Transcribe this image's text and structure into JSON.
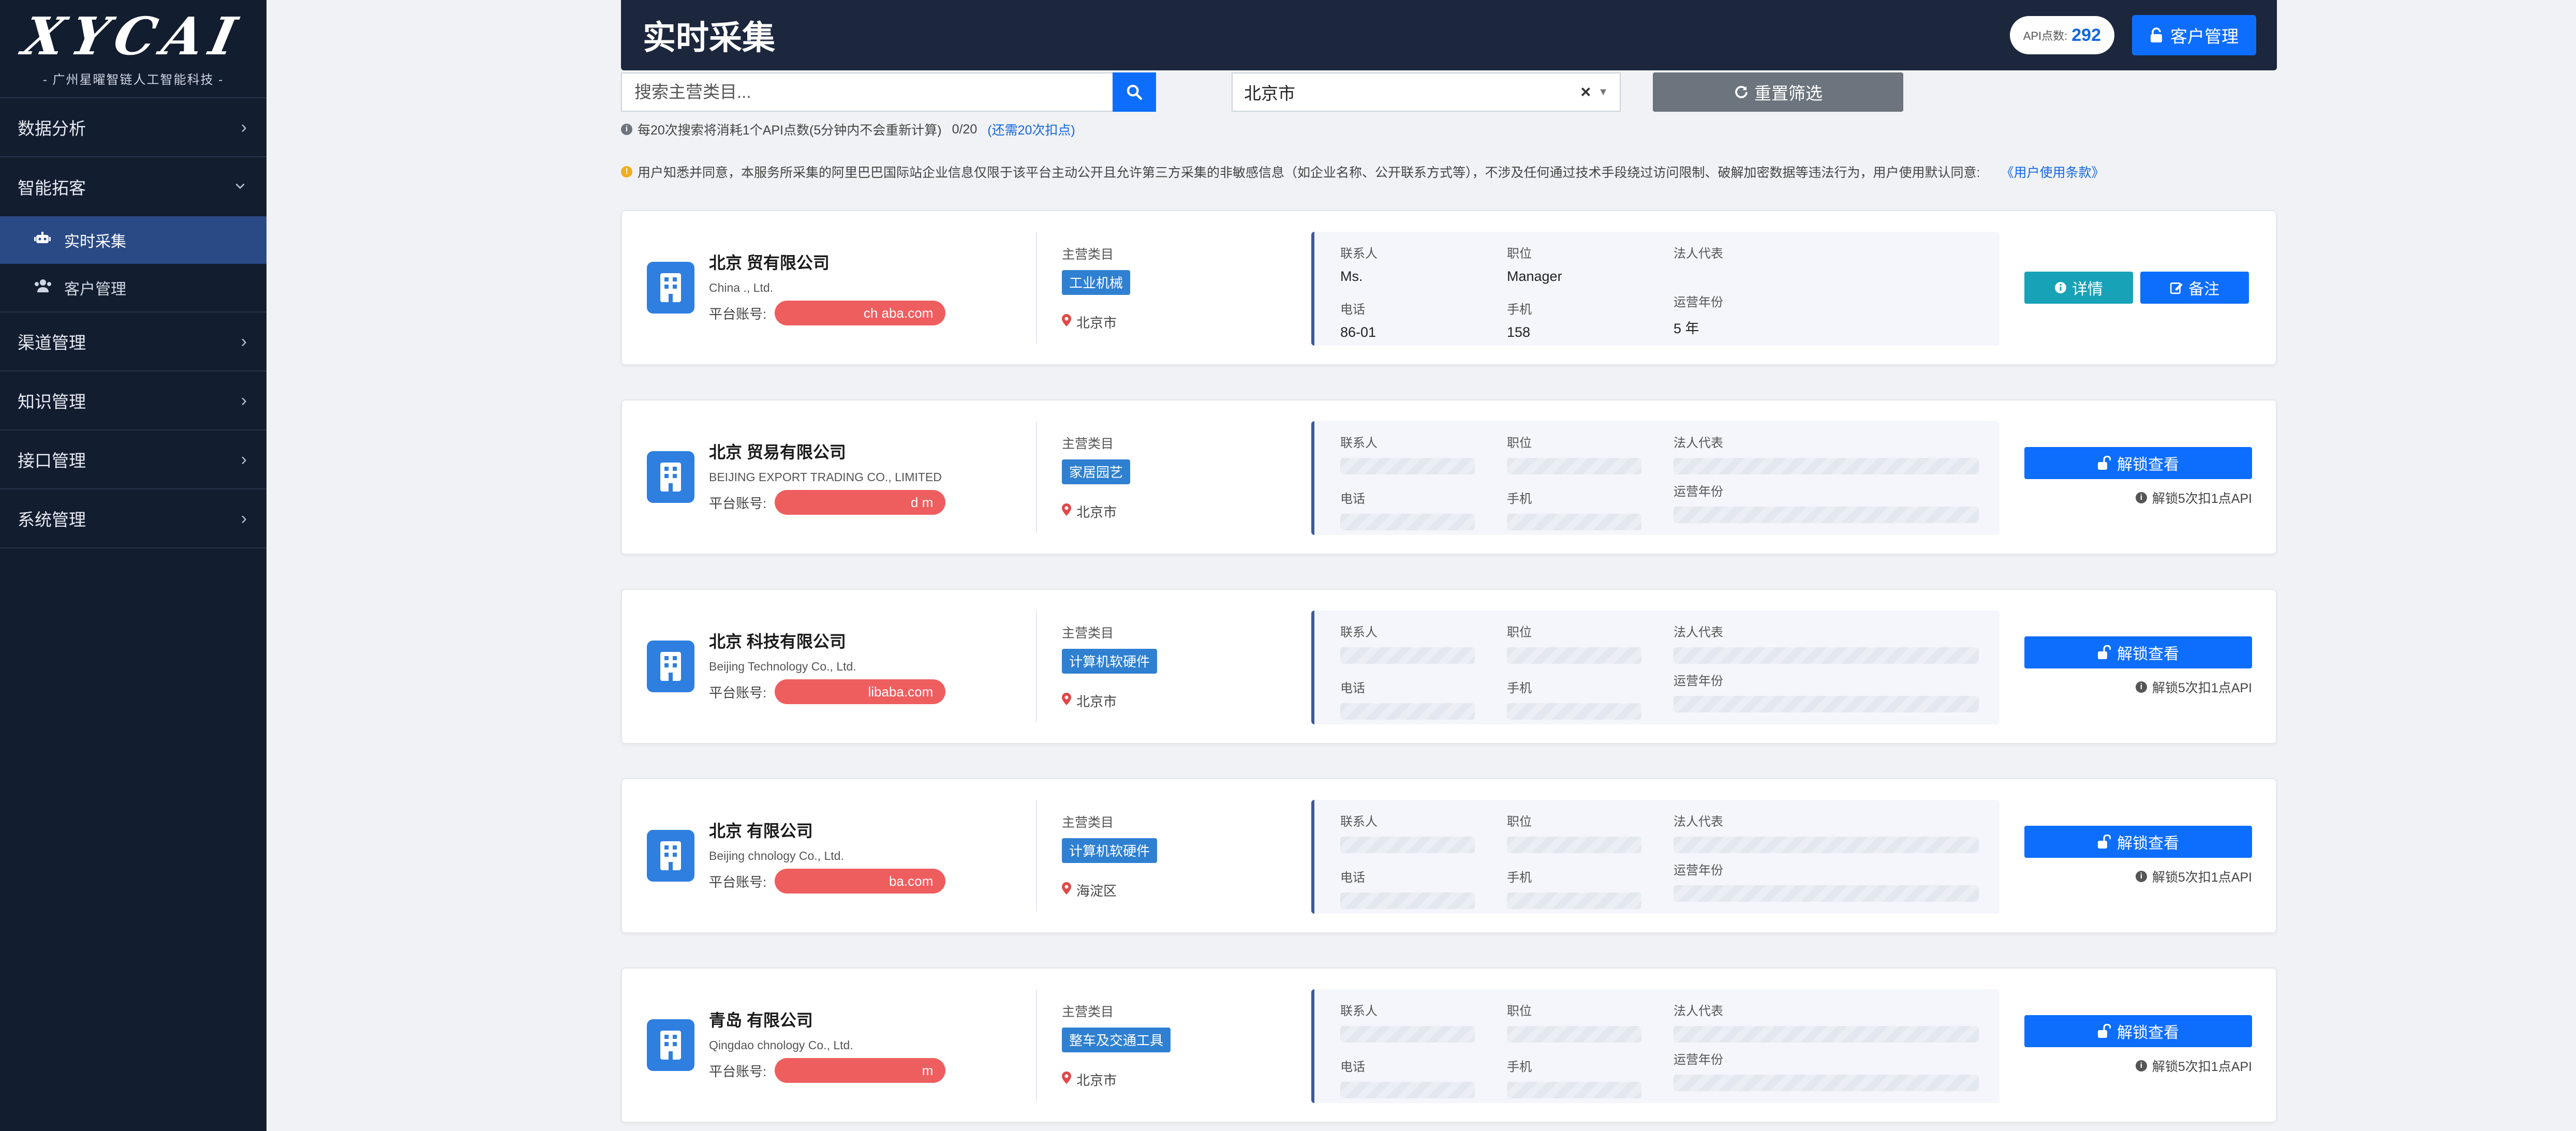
{
  "sidebar": {
    "logo": "XYCAI",
    "logo_sub": "- 广州星曜智链人工智能科技 -",
    "menu": [
      {
        "label": "数据分析",
        "chevron": "›"
      },
      {
        "label": "智能拓客",
        "chevron": "⌄"
      },
      {
        "label": "渠道管理",
        "chevron": "›"
      },
      {
        "label": "知识管理",
        "chevron": "›"
      },
      {
        "label": "接口管理",
        "chevron": "›"
      },
      {
        "label": "系统管理",
        "chevron": "›"
      }
    ],
    "submenu": [
      {
        "label": "实时采集",
        "icon": "robot-icon"
      },
      {
        "label": "客户管理",
        "icon": "users-icon"
      }
    ]
  },
  "header": {
    "title": "实时采集",
    "api_label": "API点数:",
    "api_value": "292",
    "customer_btn": "客户管理"
  },
  "filters": {
    "search_placeholder": "搜索主营类目...",
    "city_value": "北京市",
    "clear_glyph": "×",
    "reset_label": "重置筛选"
  },
  "hint": {
    "text": "每20次搜索将消耗1个API点数(5分钟内不会重新计算)",
    "count": "0/20",
    "remain": "(还需20次扣点)"
  },
  "notice": {
    "text": "用户知悉并同意，本服务所采集的阿里巴巴国际站企业信息仅限于该平台主动公开且允许第三方采集的非敏感信息（如企业名称、公开联系方式等），不涉及任何通过技术手段绕过访问限制、破解加密数据等违法行为，用户使用默认同意:",
    "link": "《用户使用条款》"
  },
  "labels": {
    "category": "主营类目",
    "account": "平台账号:",
    "contact": "联系人",
    "position": "职位",
    "legal_rep": "法人代表",
    "phone": "电话",
    "mobile": "手机",
    "years": "运营年份",
    "detail": "详情",
    "note": "备注",
    "unlock": "解锁查看",
    "unlock_hint": "解锁5次扣1点API"
  },
  "cards": [
    {
      "name": "北京                    贸有限公司",
      "name_en": "China                            ., Ltd.",
      "account": "ch                    aba.com",
      "category": "工业机械",
      "location": "北京市",
      "unlocked": true,
      "contact": "Ms.",
      "position": "Manager",
      "phone": "86-01",
      "mobile": "158",
      "years": "5 年"
    },
    {
      "name": "北京                           贸易有限公司",
      "name_en": "BEIJING                                      EXPORT TRADING CO., LIMITED",
      "account": "d                    m",
      "category": "家居园艺",
      "location": "北京市",
      "unlocked": false
    },
    {
      "name": "北京                      科技有限公司",
      "name_en": "Beijing                          Technology Co., Ltd.",
      "account": "                  libaba.com",
      "category": "计算机软硬件",
      "location": "北京市",
      "unlocked": false
    },
    {
      "name": "北京                      有限公司",
      "name_en": "Beijing                           chnology Co., Ltd.",
      "account": "                   ba.com",
      "category": "计算机软硬件",
      "location": "海淀区",
      "unlocked": false
    },
    {
      "name": "青岛                         有限公司",
      "name_en": "Qingdao                                          chnology Co., Ltd.",
      "account": "                    m",
      "category": "整车及交通工具",
      "location": "北京市",
      "unlocked": false
    }
  ]
}
